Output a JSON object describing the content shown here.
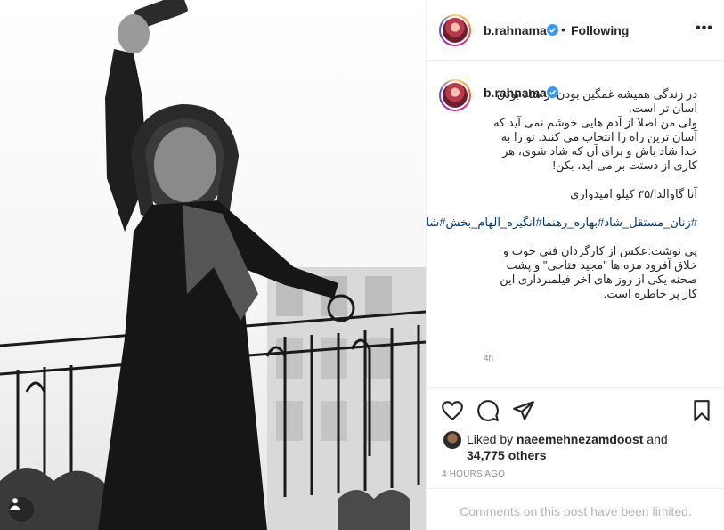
{
  "post": {
    "username": "b.rahnama",
    "follow_status": "Following",
    "separator": "•",
    "more_label": "•••"
  },
  "caption": {
    "line1": "در زندگی همیشه غمگین بودن از شاد بودن آسان تر است.",
    "line2": "ولی من اصلا از آدم هایی خوشم نمی آید که آسان ترین راه را انتخاب می کنند. تو را به خدا شاد باش و برای آن که شاد شوی، هر کاری از دستت بر می آید، بکن!",
    "line3": "آنا گاوالدا/۳۵ کیلو امیدواری",
    "hashtags": "#زنان_مستقل_شاد#بهاره_رهنما#انگیزه_الهام_بخش#شادی#لایف_استایل#زندگی#زن_باران#کوچینگ_زندگی#نویسنده#ادبیات#آنا_گاوالدا#زنان",
    "line5": "پی نوشت:عکس از کارگردان فنی خوب و خلاق آفرود مزه ها \"مجید فتاحی\" و پشت صحنه یکی از روز های آخر فیلمبرداری این کار پر خاطره است.",
    "time_ago": "4h"
  },
  "likes": {
    "prefix": "Liked by ",
    "liker": "naeemehnezamdoost",
    "and": " and",
    "others": "34,775 others"
  },
  "post_time": "4 HOURS AGO",
  "comments_notice": "Comments on this post have been limited.",
  "icons": {
    "verified": "verified-badge-icon",
    "like": "heart-icon",
    "comment": "comment-bubble-icon",
    "share": "paper-plane-icon",
    "save": "bookmark-icon",
    "tag": "user-tag-icon"
  },
  "colors": {
    "verified": "#3897f0",
    "link": "#00376b",
    "muted": "#8e8e8e",
    "notice": "#b4b4b4"
  }
}
